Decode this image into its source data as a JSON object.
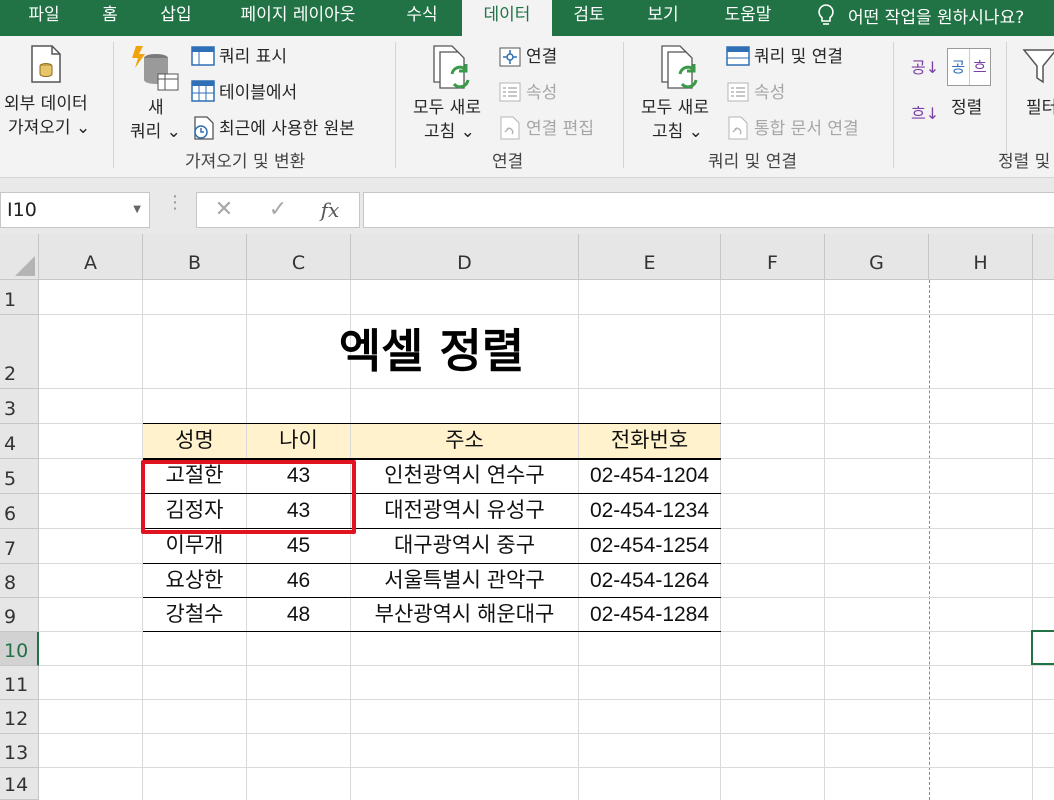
{
  "tabs": [
    "파일",
    "홈",
    "삽입",
    "페이지 레이아웃",
    "수식",
    "데이터",
    "검토",
    "보기",
    "도움말"
  ],
  "active_tab": "데이터",
  "tell_me": "어떤 작업을 원하시나요?",
  "ribbon": {
    "external_data": [
      "외부 데이터",
      "가져오기 ⌄"
    ],
    "new_query": [
      "새",
      "쿼리 ⌄"
    ],
    "show_queries": "쿼리 표시",
    "from_table": "테이블에서",
    "recent_sources": "최근에 사용한 원본",
    "group_get_transform": "가져오기 및 변환",
    "refresh_all_1": [
      "모두 새로",
      "고침 ⌄"
    ],
    "connections": "연결",
    "properties_1": "속성",
    "edit_links": "연결 편집",
    "group_connections": "연결",
    "refresh_all_2": [
      "모두 새로",
      "고침 ⌄"
    ],
    "queries_connections": "쿼리 및 연결",
    "properties_2": "속성",
    "workbook_links": "통합 문서 연결",
    "group_queries_connections": "쿼리 및 연결",
    "sort_asc": "공↓",
    "sort_desc": "흐↓",
    "sort_big": [
      "공",
      "흐"
    ],
    "sort": "정렬",
    "filter": "필터",
    "group_sort_filter": "정렬 및"
  },
  "formula_bar": {
    "name_box": "I10",
    "cancel": "✕",
    "enter": "✓",
    "fx": "fx",
    "formula": ""
  },
  "columns": [
    "A",
    "B",
    "C",
    "D",
    "E",
    "F",
    "G",
    "H"
  ],
  "rows": [
    "1",
    "2",
    "3",
    "4",
    "5",
    "6",
    "7",
    "8",
    "9",
    "10",
    "11",
    "12",
    "13",
    "14"
  ],
  "selected_row": "10",
  "sheet": {
    "title": "엑셀 정렬",
    "headers": [
      "성명",
      "나이",
      "주소",
      "전화번호"
    ],
    "records": [
      [
        "고절한",
        "43",
        "인천광역시 연수구",
        "02-454-1204"
      ],
      [
        "김정자",
        "43",
        "대전광역시 유성구",
        "02-454-1234"
      ],
      [
        "이무개",
        "45",
        "대구광역시 중구",
        "02-454-1254"
      ],
      [
        "요상한",
        "46",
        "서울특별시 관악구",
        "02-454-1264"
      ],
      [
        "강철수",
        "48",
        "부산광역시 해운대구",
        "02-454-1284"
      ]
    ]
  },
  "colors": {
    "accent": "#217346",
    "header_fill": "#fff2cc",
    "highlight": "#e0141e"
  }
}
